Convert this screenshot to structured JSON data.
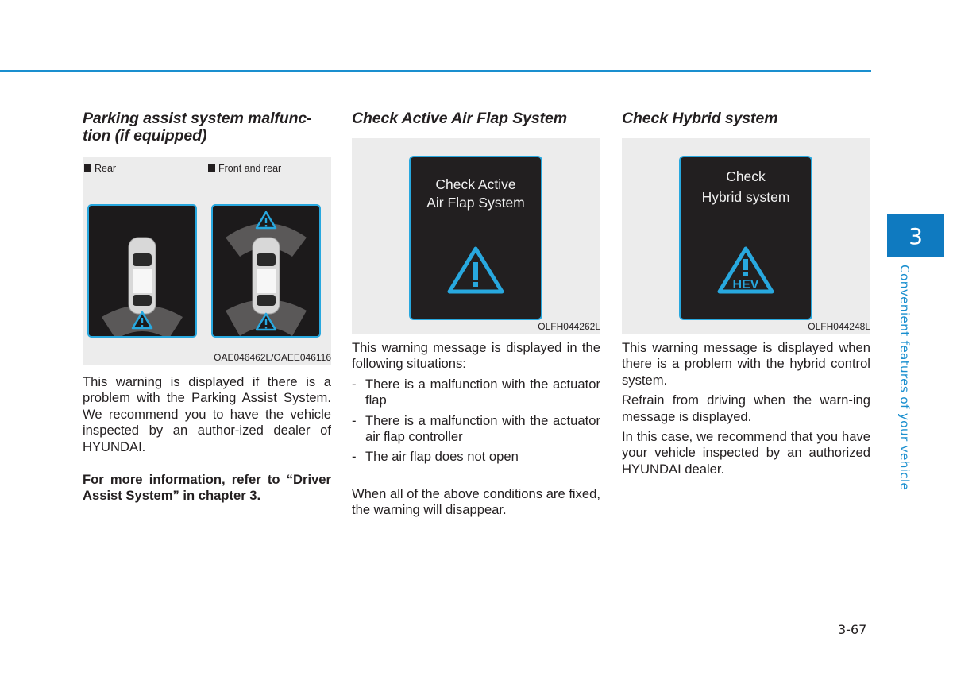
{
  "colors": {
    "accent": "#1a8fcf",
    "chapter_tab": "#0f7ac0",
    "lcd_border": "#28a8df",
    "lcd_bg": "#221f20",
    "figure_bg": "#ececec"
  },
  "chapter": {
    "number": "3",
    "title": "Convenient features of your vehicle"
  },
  "page_number": "3-67",
  "sections": [
    {
      "title_line1": "Parking assist system malfunc-",
      "title_line2": "tion (if equipped)",
      "figure": {
        "panels": [
          {
            "label": "Rear",
            "icon": "parking-rear-warning-icon"
          },
          {
            "label": "Front and rear",
            "icon": "parking-front-rear-warning-icon"
          }
        ],
        "caption": "OAE046462L/OAEE046116"
      },
      "paragraphs": [
        "This warning is displayed if there is a problem with the Parking Assist System. We recommend you to have the vehicle inspected by an author-ized dealer of HYUNDAI."
      ],
      "note": "For more information, refer to “Driver Assist System” in chapter 3."
    },
    {
      "title": "Check Active Air Flap System",
      "figure": {
        "screen_line1": "Check Active",
        "screen_line2": "Air Flap System",
        "icon": "warning-triangle-icon",
        "caption": "OLFH044262L"
      },
      "intro": "This warning message is displayed in the following situations:",
      "bullets": [
        "There is a malfunction with the actuator flap",
        "There is a malfunction with the actuator air flap controller",
        "The air flap does not open"
      ],
      "bullet_mark": "-",
      "closing": "When all of the above conditions are fixed, the warning will disappear."
    },
    {
      "title": "Check Hybrid system",
      "figure": {
        "screen_line1": "Check",
        "screen_line2": "Hybrid system",
        "icon": "hev-warning-triangle-icon",
        "icon_text": "HEV",
        "caption": "OLFH044248L"
      },
      "paragraphs": [
        "This warning message is displayed when there is a problem with the hybrid control system.",
        "Refrain from driving when the warn-ing message is displayed.",
        "In this case, we recommend that you have your vehicle inspected by an authorized HYUNDAI dealer."
      ]
    }
  ]
}
